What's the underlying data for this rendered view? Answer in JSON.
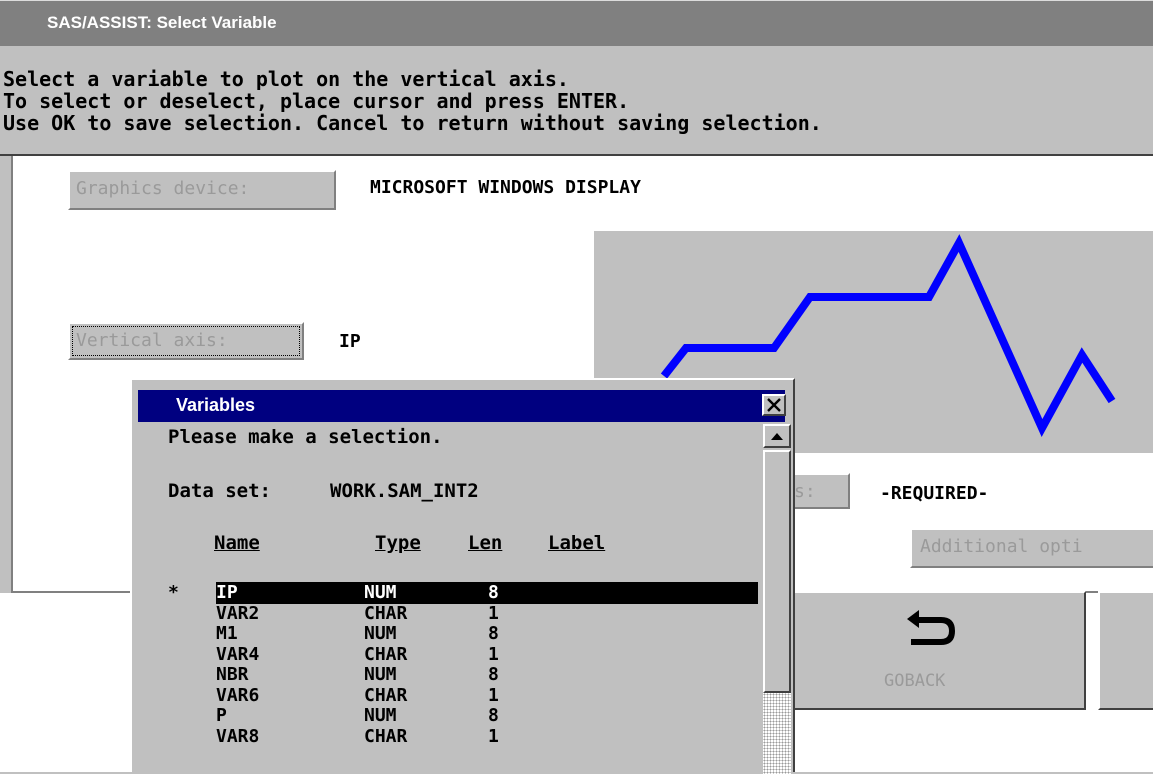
{
  "window": {
    "title": "SAS/ASSIST: Select Variable"
  },
  "instructions": [
    "Select a variable to plot on the vertical axis.",
    "To select or deselect, place cursor and press ENTER.",
    "Use OK to save selection. Cancel to return without saving selection."
  ],
  "main": {
    "graphics_device_button": "Graphics device:",
    "graphics_device_value": "MICROSOFT WINDOWS DISPLAY",
    "vertical_axis_button": "Vertical axis:",
    "vertical_axis_value": "IP",
    "horizontal_axis_button_partial": "s:",
    "horizontal_axis_value": "-REQUIRED-",
    "additional_options_button": "Additional opti",
    "goback_label": "GOBACK"
  },
  "dialog": {
    "title": "Variables",
    "prompt": "Please make a selection.",
    "dataset_label": "Data set:",
    "dataset_value": "WORK.SAM_INT2",
    "columns": [
      "Name",
      "Type",
      "Len",
      "Label"
    ],
    "rows": [
      {
        "mark": "*",
        "name": "IP",
        "type": "NUM",
        "len": "8",
        "selected": true
      },
      {
        "mark": "",
        "name": "VAR2",
        "type": "CHAR",
        "len": "1",
        "selected": false
      },
      {
        "mark": "",
        "name": "M1",
        "type": "NUM",
        "len": "8",
        "selected": false
      },
      {
        "mark": "",
        "name": "VAR4",
        "type": "CHAR",
        "len": "1",
        "selected": false
      },
      {
        "mark": "",
        "name": "NBR",
        "type": "NUM",
        "len": "8",
        "selected": false
      },
      {
        "mark": "",
        "name": "VAR6",
        "type": "CHAR",
        "len": "1",
        "selected": false
      },
      {
        "mark": "",
        "name": "P",
        "type": "NUM",
        "len": "8",
        "selected": false
      },
      {
        "mark": "",
        "name": "VAR8",
        "type": "CHAR",
        "len": "1",
        "selected": false
      }
    ]
  },
  "colors": {
    "title_bar": "#808080",
    "dialog_title": "#000080",
    "graph_line": "#0000ff",
    "selection": "#000000"
  }
}
